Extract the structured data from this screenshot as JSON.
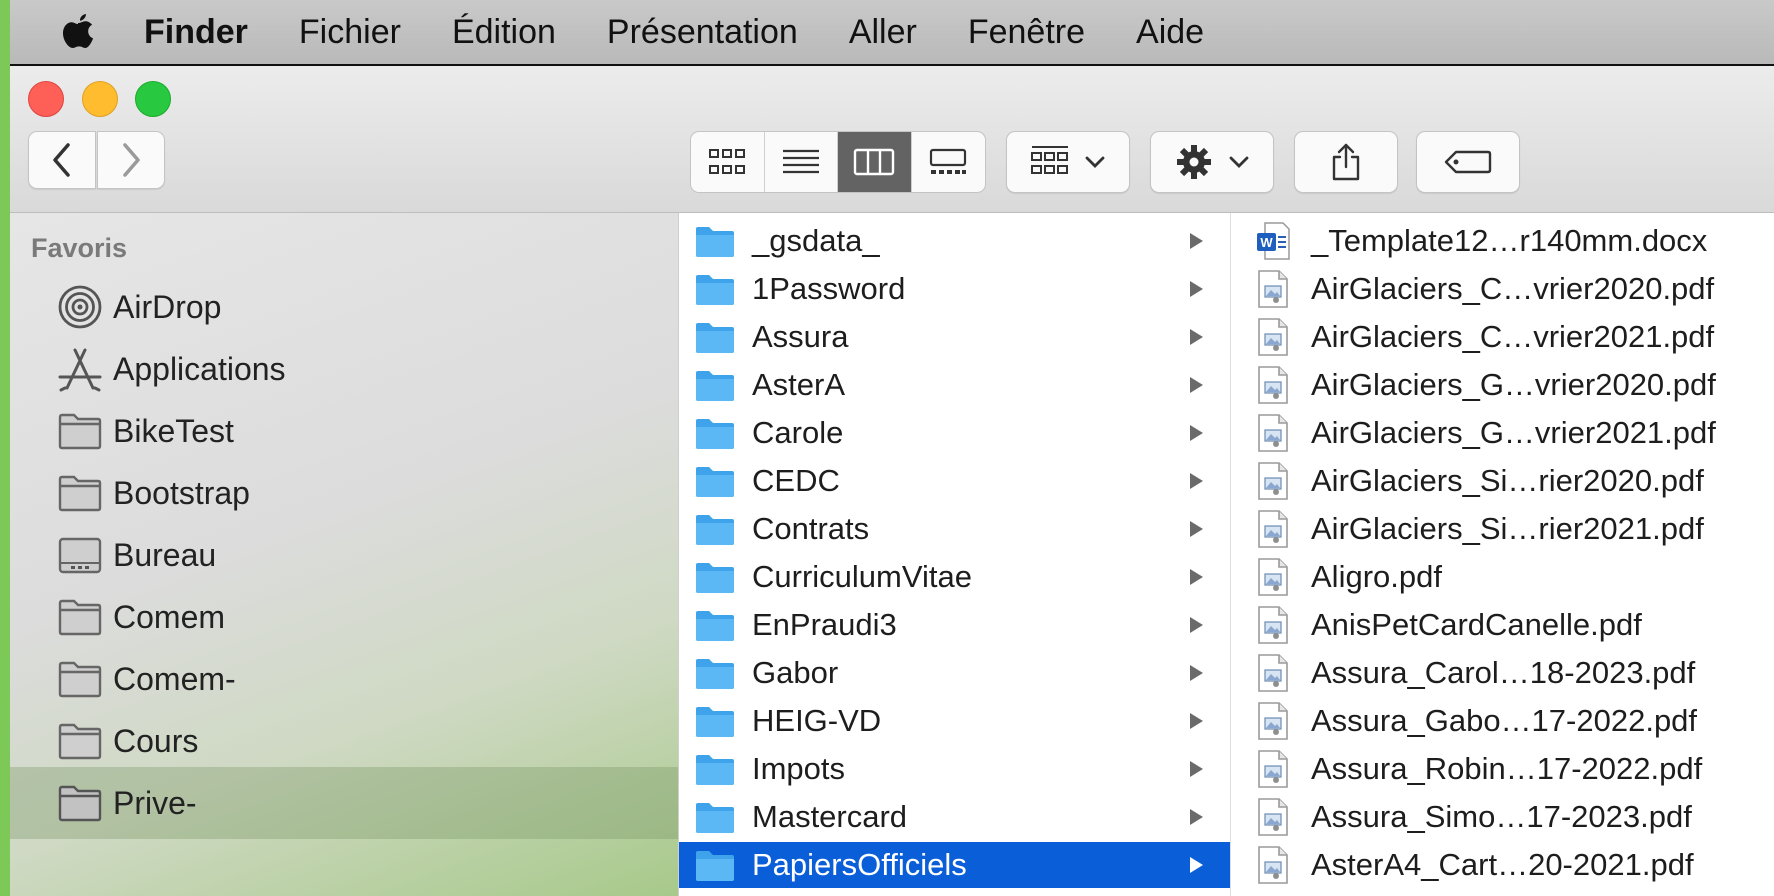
{
  "menubar": {
    "app_name": "Finder",
    "items": [
      "Fichier",
      "Édition",
      "Présentation",
      "Aller",
      "Fenêtre",
      "Aide"
    ]
  },
  "toolbar": {
    "view_modes": [
      "icon-view",
      "list-view",
      "column-view",
      "gallery-view"
    ],
    "active_view": "column-view"
  },
  "sidebar": {
    "section_title": "Favoris",
    "items": [
      {
        "label": "AirDrop",
        "icon": "airdrop-icon"
      },
      {
        "label": "Applications",
        "icon": "applications-icon"
      },
      {
        "label": "BikeTest",
        "icon": "folder-icon"
      },
      {
        "label": "Bootstrap",
        "icon": "folder-icon"
      },
      {
        "label": "Bureau",
        "icon": "desktop-folder-icon"
      },
      {
        "label": "Comem",
        "icon": "folder-icon"
      },
      {
        "label": "Comem-",
        "icon": "folder-icon"
      },
      {
        "label": "Cours",
        "icon": "folder-icon"
      },
      {
        "label": "Prive-",
        "icon": "folder-icon",
        "selected": true
      }
    ]
  },
  "folders_column": {
    "items": [
      "_gsdata_",
      "1Password",
      "Assura",
      "AsterA",
      "Carole",
      "CEDC",
      "Contrats",
      "CurriculumVitae",
      "EnPraudi3",
      "Gabor",
      "HEIG-VD",
      "Impots",
      "Mastercard",
      "PapiersOfficiels"
    ],
    "selected": "PapiersOfficiels"
  },
  "files_column": {
    "items": [
      {
        "name": "_Template12…r140mm.docx",
        "type": "docx"
      },
      {
        "name": "AirGlaciers_C…vrier2020.pdf",
        "type": "pdf"
      },
      {
        "name": "AirGlaciers_C…vrier2021.pdf",
        "type": "pdf"
      },
      {
        "name": "AirGlaciers_G…vrier2020.pdf",
        "type": "pdf"
      },
      {
        "name": "AirGlaciers_G…vrier2021.pdf",
        "type": "pdf"
      },
      {
        "name": "AirGlaciers_Si…rier2020.pdf",
        "type": "pdf"
      },
      {
        "name": "AirGlaciers_Si…rier2021.pdf",
        "type": "pdf"
      },
      {
        "name": "Aligro.pdf",
        "type": "pdf"
      },
      {
        "name": "AnisPetCardCanelle.pdf",
        "type": "pdf"
      },
      {
        "name": "Assura_Carol…18-2023.pdf",
        "type": "pdf"
      },
      {
        "name": "Assura_Gabo…17-2022.pdf",
        "type": "pdf"
      },
      {
        "name": "Assura_Robin…17-2022.pdf",
        "type": "pdf"
      },
      {
        "name": "Assura_Simo…17-2023.pdf",
        "type": "pdf"
      },
      {
        "name": "AsterA4_Cart…20-2021.pdf",
        "type": "pdf"
      }
    ]
  },
  "colors": {
    "selection_blue": "#0a5fd9",
    "folder_blue": "#42a9f0",
    "desktop_green": "#7cc957"
  }
}
